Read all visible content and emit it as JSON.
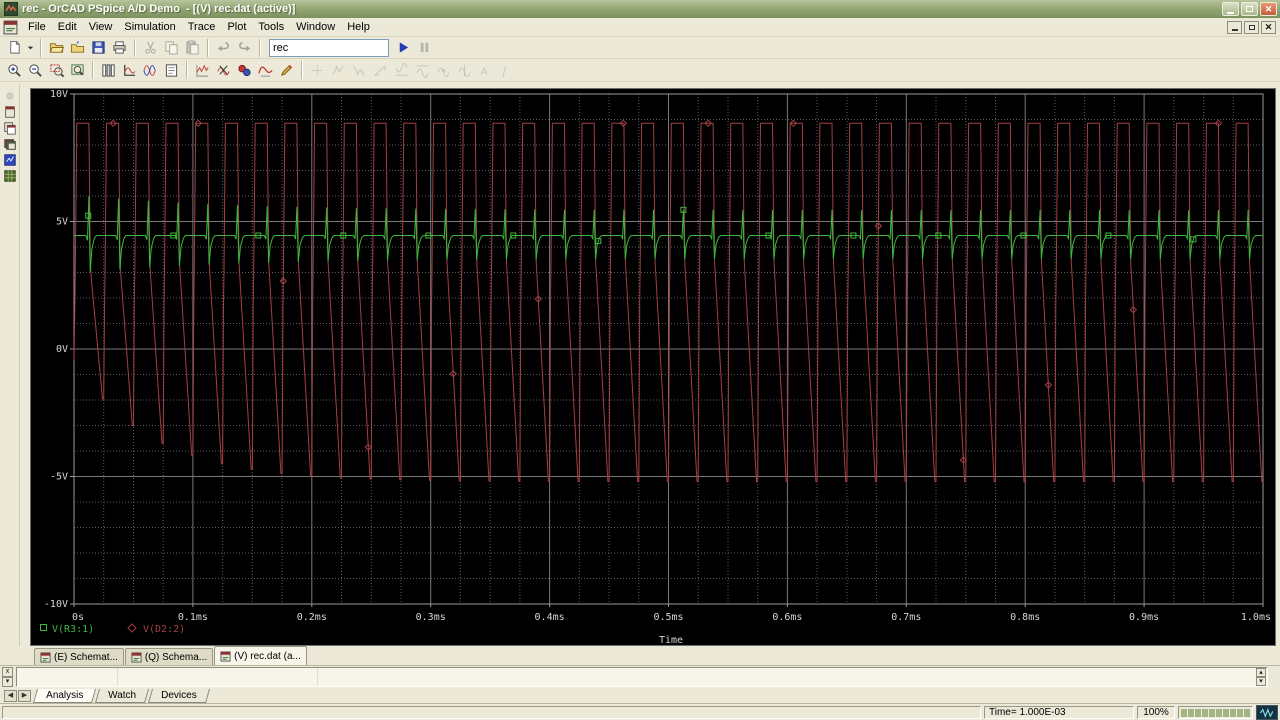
{
  "window": {
    "title": "rec - OrCAD PSpice A/D Demo  - [(V) rec.dat (active)]"
  },
  "menu": {
    "items": [
      "File",
      "Edit",
      "View",
      "Simulation",
      "Trace",
      "Plot",
      "Tools",
      "Window",
      "Help"
    ]
  },
  "toolbars": {
    "run_combo": {
      "value": "rec"
    },
    "row1_groups": [
      {
        "buttons": [
          {
            "name": "new-simulation-button",
            "icon": "new-page-icon"
          },
          {
            "name": "new-dropdown-button",
            "icon": "chevron-down-icon",
            "narrow": true
          }
        ]
      },
      {
        "buttons": [
          {
            "name": "open-button",
            "icon": "open-folder-icon"
          },
          {
            "name": "append-file-button",
            "icon": "folder-arrow-icon"
          },
          {
            "name": "save-button",
            "icon": "save-icon"
          },
          {
            "name": "print-button",
            "icon": "print-icon"
          }
        ]
      },
      {
        "buttons": [
          {
            "name": "cut-button",
            "icon": "cut-icon",
            "disabled": true
          },
          {
            "name": "copy-button",
            "icon": "copy-icon",
            "disabled": true
          },
          {
            "name": "paste-button",
            "icon": "paste-icon",
            "disabled": true
          }
        ]
      },
      {
        "buttons": [
          {
            "name": "undo-button",
            "icon": "undo-icon",
            "disabled": true
          },
          {
            "name": "redo-button",
            "icon": "redo-icon",
            "disabled": true
          }
        ]
      },
      {
        "combo": true,
        "buttons": [
          {
            "name": "run-button",
            "icon": "run-icon"
          },
          {
            "name": "pause-button",
            "icon": "pause-icon",
            "disabled": true
          }
        ]
      }
    ],
    "row2_groups": [
      {
        "buttons": [
          {
            "name": "zoom-in-button",
            "icon": "zoom-in-icon"
          },
          {
            "name": "zoom-out-button",
            "icon": "zoom-out-icon"
          },
          {
            "name": "zoom-area-button",
            "icon": "zoom-area-icon"
          },
          {
            "name": "zoom-fit-button",
            "icon": "zoom-fit-icon"
          }
        ]
      },
      {
        "buttons": [
          {
            "name": "plot-pages-button",
            "icon": "columns-icon"
          },
          {
            "name": "axis-settings-button",
            "icon": "axis-icon"
          },
          {
            "name": "fourier-button",
            "icon": "fourier-icon"
          },
          {
            "name": "plot-list-button",
            "icon": "list-icon"
          }
        ]
      },
      {
        "buttons": [
          {
            "name": "add-trace-button",
            "icon": "add-trace-icon"
          },
          {
            "name": "delete-traces-button",
            "icon": "delete-trace-icon"
          },
          {
            "name": "goal-functions-button",
            "icon": "goal-icon"
          },
          {
            "name": "macros-button",
            "icon": "macro-wave-icon"
          },
          {
            "name": "edit-trace-button",
            "icon": "edit-pencil-icon"
          }
        ]
      },
      {
        "buttons": [
          {
            "name": "cursor-toggle-button",
            "icon": "cursor-toggle-icon",
            "disabled": true
          },
          {
            "name": "cursor-peak-button",
            "icon": "cursor-peak-icon",
            "disabled": true
          },
          {
            "name": "cursor-trough-button",
            "icon": "cursor-trough-icon",
            "disabled": true
          },
          {
            "name": "cursor-slope-button",
            "icon": "cursor-slope-icon",
            "disabled": true
          },
          {
            "name": "cursor-min-button",
            "icon": "cursor-min-icon",
            "disabled": true
          },
          {
            "name": "cursor-max-button",
            "icon": "cursor-max-icon",
            "disabled": true
          },
          {
            "name": "cursor-point-button",
            "icon": "cursor-point-icon",
            "disabled": true
          },
          {
            "name": "cursor-search-button",
            "icon": "cursor-search-icon",
            "disabled": true
          },
          {
            "name": "cursor-label-button",
            "icon": "cursor-label-icon",
            "disabled": true
          },
          {
            "name": "cursor-eval-button",
            "icon": "cursor-eval-icon",
            "disabled": true
          }
        ]
      }
    ]
  },
  "side_icons": [
    {
      "name": "record-macro-button",
      "icon": "dot-icon",
      "disabled": true
    },
    {
      "name": "schematic-page-button",
      "icon": "page-icon"
    },
    {
      "name": "copy-page-button",
      "icon": "pages-icon"
    },
    {
      "name": "cascade-windows-button",
      "icon": "stack-icon"
    },
    {
      "name": "simulation-results-button",
      "icon": "blue-window-icon"
    },
    {
      "name": "simulation-queue-button",
      "icon": "green-grid-icon"
    }
  ],
  "mdi_tabs": [
    {
      "label": "(E) Schemat...",
      "active": false
    },
    {
      "label": "(Q) Schema...",
      "active": false
    },
    {
      "label": "(V) rec.dat (a...",
      "active": true
    }
  ],
  "output_window": {
    "tabs": [
      {
        "label": "Analysis",
        "active": true
      },
      {
        "label": "Watch",
        "active": false
      },
      {
        "label": "Devices",
        "active": false
      }
    ]
  },
  "status": {
    "time": "Time= 1.000E-03",
    "percent": "100%",
    "progress_blocks": 10
  },
  "chart_data": {
    "type": "line",
    "title": "",
    "xlabel": "Time",
    "ylabel": "",
    "x_range_ms": [
      0,
      1.0
    ],
    "y_range_v": [
      -10,
      10
    ],
    "x_ticks": [
      {
        "t": 0,
        "label": "0s"
      },
      {
        "t": 0.1,
        "label": "0.1ms"
      },
      {
        "t": 0.2,
        "label": "0.2ms"
      },
      {
        "t": 0.3,
        "label": "0.3ms"
      },
      {
        "t": 0.4,
        "label": "0.4ms"
      },
      {
        "t": 0.5,
        "label": "0.5ms"
      },
      {
        "t": 0.6,
        "label": "0.6ms"
      },
      {
        "t": 0.7,
        "label": "0.7ms"
      },
      {
        "t": 0.8,
        "label": "0.8ms"
      },
      {
        "t": 0.9,
        "label": "0.9ms"
      },
      {
        "t": 1.0,
        "label": "1.0ms"
      }
    ],
    "y_ticks": [
      {
        "v": 10,
        "label": "10V"
      },
      {
        "v": 5,
        "label": "5V"
      },
      {
        "v": 0,
        "label": "0V"
      },
      {
        "v": -5,
        "label": "-5V"
      },
      {
        "v": -10,
        "label": "-10V"
      }
    ],
    "grid": {
      "major_x_ms": 0.1,
      "minor_x_ms": 0.025,
      "major_y_v": 5,
      "minor_y_v": 1,
      "major_color": "#787878",
      "minor_color": "#5c5c5c",
      "border_color": "#9a9a9a"
    },
    "background": "#000000",
    "text_color": "#d6d6d6",
    "legend_position": "bottom-left",
    "marker_interval_ms": 0.0715,
    "series": [
      {
        "name": "V(R3:1)",
        "color": "#3db83d",
        "marker": "square",
        "model": {
          "kind": "regulated-output-with-switching-spikes",
          "period_ms": 0.025,
          "baseline_v": 4.45,
          "spike_up_v": 1.0,
          "spike_down_v": 0.92,
          "spike_decay_extra": 0.55,
          "spike_decay_tau_ms": 0.12
        }
      },
      {
        "name": "V(D2:2)",
        "color": "#a34045",
        "marker": "diamond",
        "model": {
          "kind": "switching-node-square-wave",
          "period_ms": 0.025,
          "flat_top_v": 8.85,
          "notch_v": 3.1,
          "neg_peak_initial_v": -0.45,
          "neg_peak_steady_v": -5.2,
          "neg_peak_tau_ms": 0.065
        }
      }
    ]
  }
}
